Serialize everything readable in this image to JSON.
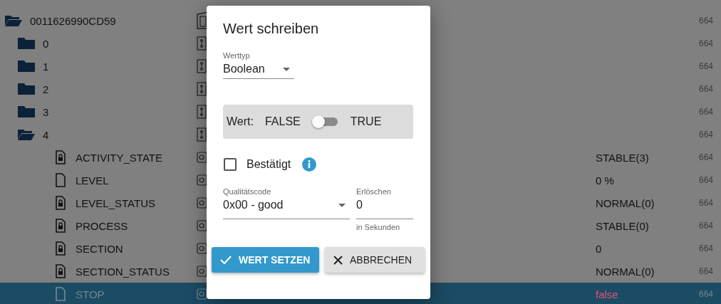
{
  "tree": [
    {
      "name": "0011626990CD59",
      "kind": "device",
      "expanded": true,
      "selected": false,
      "count": "664",
      "children": [
        {
          "name": "0",
          "kind": "channel",
          "expanded": false,
          "selected": false,
          "count": "664"
        },
        {
          "name": "1",
          "kind": "channel",
          "expanded": false,
          "selected": false,
          "count": "664"
        },
        {
          "name": "2",
          "kind": "channel",
          "expanded": false,
          "selected": false,
          "count": "664"
        },
        {
          "name": "3",
          "kind": "channel",
          "expanded": false,
          "selected": false,
          "count": "664"
        },
        {
          "name": "4",
          "kind": "channel",
          "expanded": true,
          "selected": false,
          "count": "664",
          "children": [
            {
              "name": "ACTIVITY_STATE",
              "kind": "state",
              "locked": true,
              "selected": false,
              "value": "STABLE(3)",
              "count": "664"
            },
            {
              "name": "LEVEL",
              "kind": "state",
              "locked": false,
              "selected": false,
              "value": "0 %",
              "count": "664"
            },
            {
              "name": "LEVEL_STATUS",
              "kind": "state",
              "locked": true,
              "selected": false,
              "value": "NORMAL(0)",
              "count": "664"
            },
            {
              "name": "PROCESS",
              "kind": "state",
              "locked": true,
              "selected": false,
              "value": "STABLE(0)",
              "count": "664"
            },
            {
              "name": "SECTION",
              "kind": "state",
              "locked": true,
              "selected": false,
              "value": "0",
              "count": "664"
            },
            {
              "name": "SECTION_STATUS",
              "kind": "state",
              "locked": true,
              "selected": false,
              "value": "NORMAL(0)",
              "count": "664"
            },
            {
              "name": "STOP",
              "kind": "state",
              "locked": false,
              "selected": true,
              "value": "false",
              "count": "664"
            }
          ]
        }
      ]
    }
  ],
  "dialog": {
    "title": "Wert schreiben",
    "value_type": {
      "label": "Werttyp",
      "value": "Boolean"
    },
    "value_switch": {
      "label": "Wert:",
      "off_label": "FALSE",
      "on_label": "TRUE",
      "on": false
    },
    "acknowledged": {
      "label": "Bestätigt",
      "checked": false
    },
    "quality": {
      "label": "Qualitätscode",
      "value": "0x00 - good"
    },
    "expire": {
      "label": "Erlöschen",
      "value": "0",
      "helper": "in Sekunden"
    },
    "buttons": [
      {
        "kind": "primary",
        "label": "WERT SETZEN"
      },
      {
        "kind": "cancel",
        "label": "ABBRECHEN"
      }
    ]
  }
}
